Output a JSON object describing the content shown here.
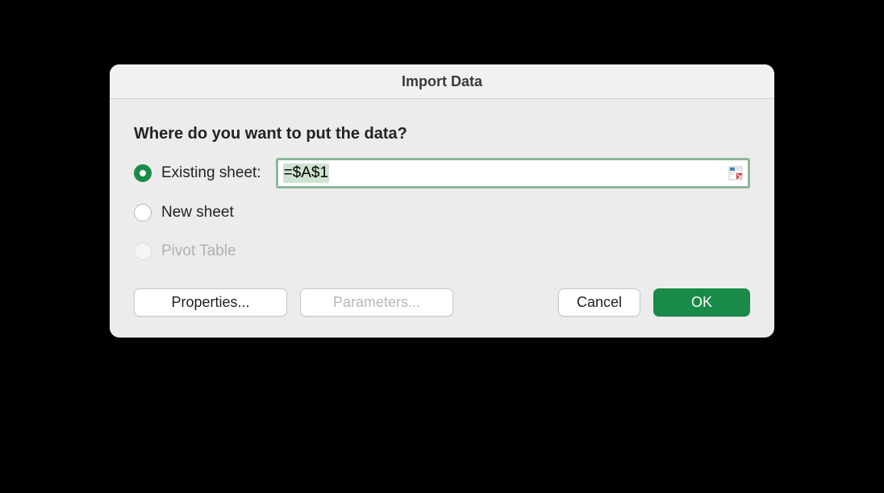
{
  "dialog": {
    "title": "Import Data",
    "prompt": "Where do you want to put the data?",
    "options": {
      "existing_sheet": {
        "label": "Existing sheet:",
        "value": "=$A$1",
        "selected": true
      },
      "new_sheet": {
        "label": "New sheet",
        "selected": false
      },
      "pivot_table": {
        "label": "Pivot Table",
        "selected": false,
        "disabled": true
      }
    },
    "buttons": {
      "properties": "Properties...",
      "parameters": "Parameters...",
      "cancel": "Cancel",
      "ok": "OK"
    }
  }
}
